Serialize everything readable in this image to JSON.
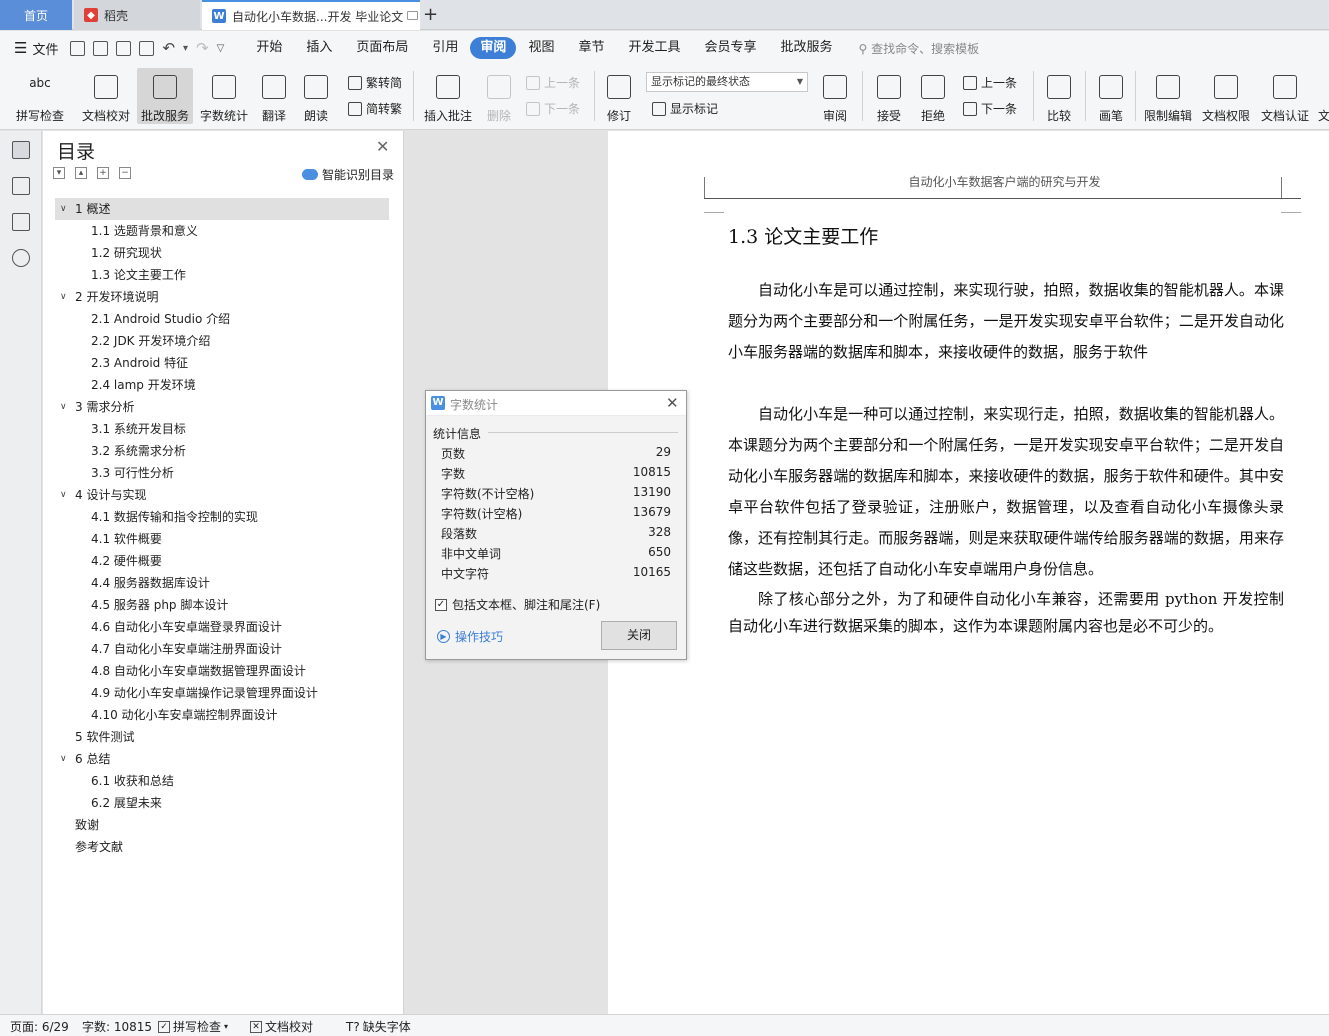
{
  "tabs": {
    "home": "首页",
    "daoke": "稻壳",
    "doc": "自动化小车数据...开发 毕业论文"
  },
  "menu": {
    "file": "文件",
    "items": [
      "开始",
      "插入",
      "页面布局",
      "引用",
      "审阅",
      "视图",
      "章节",
      "开发工具",
      "会员专享",
      "批改服务"
    ],
    "active": "审阅",
    "search_placeholder": "查找命令、搜索模板"
  },
  "ribbon": {
    "spellcheck": "拼写检查",
    "doc_check": "文档校对",
    "correction": "批改服务",
    "word_count": "字数统计",
    "translate": "翻译",
    "read_aloud": "朗读",
    "trad": "繁转简",
    "simp": "简转繁",
    "insert_comment": "插入批注",
    "delete": "删除",
    "prev_comment": "上一条",
    "next_comment": "下一条",
    "revise": "修订",
    "markup_state": "显示标记的最终状态",
    "show_markup": "显示标记",
    "review": "审阅",
    "accept": "接受",
    "reject": "拒绝",
    "prev_change": "上一条",
    "next_change": "下一条",
    "compare": "比较",
    "pen": "画笔",
    "restrict": "限制编辑",
    "doc_rights": "文档权限",
    "doc_cert": "文档认证",
    "overflow": "文"
  },
  "toc": {
    "title": "目录",
    "smart": "智能识别目录",
    "items": [
      {
        "text": "1 概述",
        "level": 1,
        "expanded": true,
        "selected": true
      },
      {
        "text": "1.1 选题背景和意义",
        "level": 2
      },
      {
        "text": "1.2 研究现状",
        "level": 2
      },
      {
        "text": "1.3 论文主要工作",
        "level": 2
      },
      {
        "text": "2  开发环境说明",
        "level": 1,
        "expanded": true
      },
      {
        "text": "2.1 Android Studio 介绍",
        "level": 2
      },
      {
        "text": "2.2 JDK 开发环境介绍",
        "level": 2
      },
      {
        "text": "2.3 Android 特征",
        "level": 2
      },
      {
        "text": "2.4 lamp 开发环境",
        "level": 2
      },
      {
        "text": "3  需求分析",
        "level": 1,
        "expanded": true
      },
      {
        "text": "3.1 系统开发目标",
        "level": 2
      },
      {
        "text": "3.2 系统需求分析",
        "level": 2
      },
      {
        "text": "3.3 可行性分析",
        "level": 2
      },
      {
        "text": "4  设计与实现",
        "level": 1,
        "expanded": true
      },
      {
        "text": "4.1 数据传输和指令控制的实现",
        "level": 2
      },
      {
        "text": "4.1 软件概要",
        "level": 2
      },
      {
        "text": "4.2 硬件概要",
        "level": 2
      },
      {
        "text": "4.4 服务器数据库设计",
        "level": 2
      },
      {
        "text": "4.5 服务器 php 脚本设计",
        "level": 2
      },
      {
        "text": "4.6 自动化小车安卓端登录界面设计",
        "level": 2
      },
      {
        "text": "4.7 自动化小车安卓端注册界面设计",
        "level": 2
      },
      {
        "text": "4.8 自动化小车安卓端数据管理界面设计",
        "level": 2
      },
      {
        "text": "4.9 动化小车安卓端操作记录管理界面设计",
        "level": 2
      },
      {
        "text": "4.10 动化小车安卓端控制界面设计",
        "level": 2
      },
      {
        "text": "5  软件测试",
        "level": 1
      },
      {
        "text": "6 总结",
        "level": 1,
        "expanded": true
      },
      {
        "text": "6.1 收获和总结",
        "level": 2
      },
      {
        "text": "6.2 展望未来",
        "level": 2
      },
      {
        "text": "致谢",
        "level": 1
      },
      {
        "text": "参考文献",
        "level": 1
      }
    ]
  },
  "document": {
    "header": "自动化小车数据客户端的研究与开发",
    "heading": "1.3 论文主要工作",
    "paragraphs": [
      "自动化小车是可以通过控制，来实现行驶，拍照，数据收集的智能机器人。本课题分为两个主要部分和一个附属任务，一是开发实现安卓平台软件；二是开发自动化小车服务器端的数据库和脚本，来接收硬件的数据，服务于软件",
      "自动化小车是一种可以通过控制，来实现行走，拍照，数据收集的智能机器人。本课题分为两个主要部分和一个附属任务，一是开发实现安卓平台软件；二是开发自动化小车服务器端的数据库和脚本，来接收硬件的数据，服务于软件和硬件。其中安卓平台软件包括了登录验证，注册账户，数据管理，以及查看自动化小车摄像头录像，还有控制其行走。而服务器端，则是来获取硬件端传给服务器端的数据，用来存储这些数据，还包括了自动化小车安卓端用户身份信息。",
      "除了核心部分之外，为了和硬件自动化小车兼容，还需要用 python 开发控制自动化小车进行数据采集的脚本，这作为本课题附属内容也是必不可少的。"
    ]
  },
  "dialog": {
    "title": "字数统计",
    "group": "统计信息",
    "rows": [
      {
        "label": "页数",
        "value": "29"
      },
      {
        "label": "字数",
        "value": "10815"
      },
      {
        "label": "字符数(不计空格)",
        "value": "13190"
      },
      {
        "label": "字符数(计空格)",
        "value": "13679"
      },
      {
        "label": "段落数",
        "value": "328"
      },
      {
        "label": "非中文单词",
        "value": "650"
      },
      {
        "label": "中文字符",
        "value": "10165"
      }
    ],
    "checkbox": "包括文本框、脚注和尾注(F)",
    "checked": true,
    "tips": "操作技巧",
    "close": "关闭"
  },
  "status": {
    "page": "页面: 6/29",
    "words": "字数: 10815",
    "spell": "拼写检查",
    "doccheck": "文档校对",
    "missing_font": "缺失字体"
  },
  "colors": {
    "accent": "#3d7fd6",
    "home_tab": "#5a8ed8"
  }
}
